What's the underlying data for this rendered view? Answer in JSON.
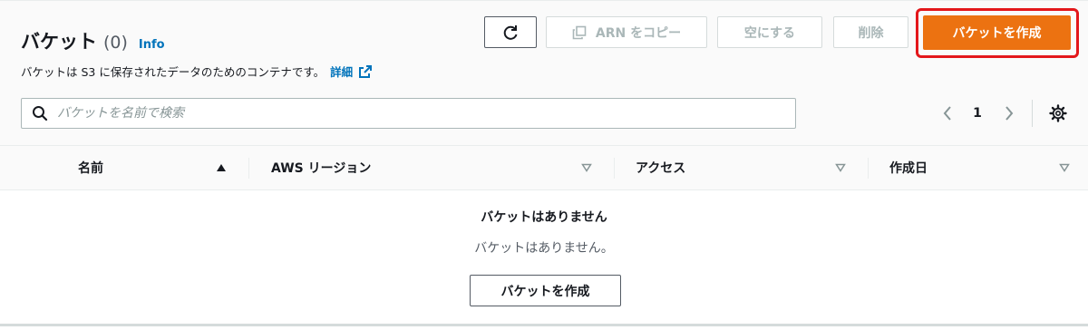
{
  "header": {
    "title": "バケット",
    "count": "(0)",
    "info": "Info",
    "description": "バケットは S3 に保存されたデータのためのコンテナです。",
    "more_link": "詳細"
  },
  "actions": {
    "refresh_icon": "refresh-icon",
    "copy_arn": "ARN をコピー",
    "empty": "空にする",
    "delete": "削除",
    "create": "バケットを作成"
  },
  "search": {
    "placeholder": "バケットを名前で検索",
    "value": ""
  },
  "pagination": {
    "current_page": "1"
  },
  "table": {
    "columns": [
      {
        "label": "名前",
        "sort": "ascending"
      },
      {
        "label": "AWS リージョン",
        "sort": "none"
      },
      {
        "label": "アクセス",
        "sort": "none"
      },
      {
        "label": "作成日",
        "sort": "none"
      }
    ]
  },
  "empty_state": {
    "title": "バケットはありません",
    "description": "バケットはありません。",
    "button": "バケットを作成"
  },
  "colors": {
    "primary": "#ec7211",
    "highlight": "#e3171b",
    "link": "#0073bb"
  }
}
